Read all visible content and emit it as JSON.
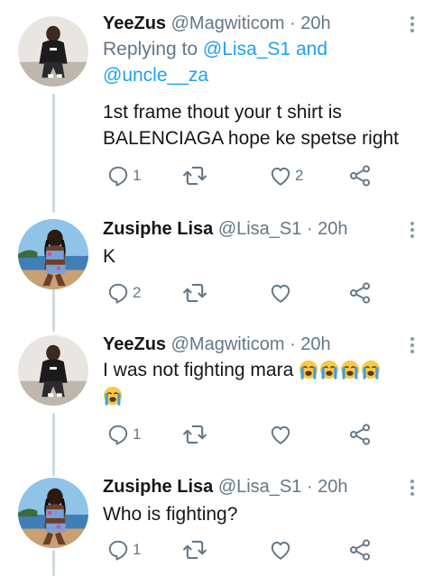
{
  "tweets": [
    {
      "name": "YeeZus",
      "handle": "@Magwiticom",
      "time": "· 20h",
      "reply_prefix": "Replying to",
      "reply_user_1": "@Lisa_S1",
      "reply_and": "and",
      "reply_user_2": "@uncle__za",
      "text": "1st frame thout your t shirt is BALENCIAGA hope ke spetse right",
      "replies": "1",
      "likes": "2"
    },
    {
      "name": "Zusiphe Lisa",
      "handle": "@Lisa_S1",
      "time": "· 20h",
      "text": "K",
      "replies": "2",
      "likes": ""
    },
    {
      "name": "YeeZus",
      "handle": "@Magwiticom",
      "time": "· 20h",
      "text": "I was not fighting mara",
      "emoji_count": 5,
      "emoji": "loudly-crying-face",
      "replies": "1",
      "likes": ""
    },
    {
      "name": "Zusiphe Lisa",
      "handle": "@Lisa_S1",
      "time": "· 20h",
      "text": "Who is fighting?",
      "replies": "1",
      "likes": ""
    }
  ],
  "icons": {
    "reply": "reply-icon",
    "retweet": "retweet-icon",
    "like": "heart-icon",
    "share": "share-icon",
    "more": "more-vertical-icon"
  },
  "colors": {
    "text": "#14171a",
    "secondary": "#657786",
    "link": "#1da1f2",
    "thread_line": "#cfd9de"
  }
}
